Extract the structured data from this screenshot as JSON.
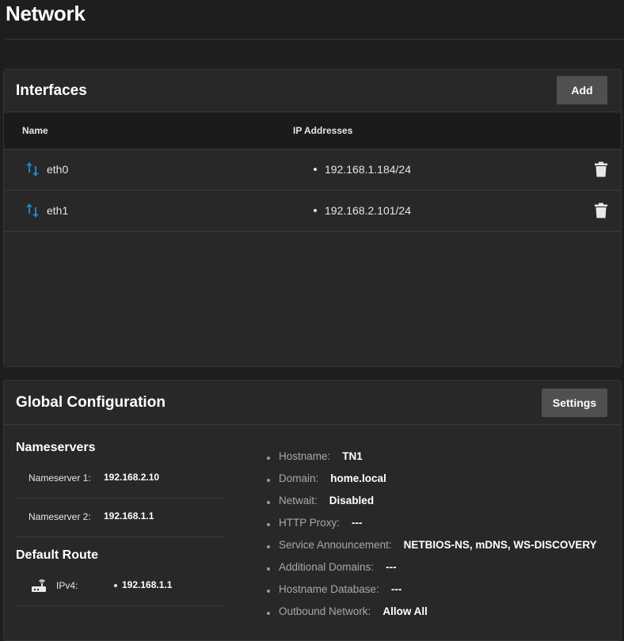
{
  "page": {
    "title": "Network"
  },
  "interfaces": {
    "title": "Interfaces",
    "add_label": "Add",
    "columns": {
      "name": "Name",
      "ip": "IP Addresses"
    },
    "rows": [
      {
        "name": "eth0",
        "ip": "192.168.1.184/24",
        "icon": "swap-vert-icon"
      },
      {
        "name": "eth1",
        "ip": "192.168.2.101/24",
        "icon": "swap-vert-icon"
      }
    ]
  },
  "global": {
    "title": "Global Configuration",
    "settings_label": "Settings",
    "nameservers": {
      "title": "Nameservers",
      "items": [
        {
          "label": "Nameserver 1:",
          "value": "192.168.2.10"
        },
        {
          "label": "Nameserver 2:",
          "value": "192.168.1.1"
        }
      ]
    },
    "default_route": {
      "title": "Default Route",
      "label": "IPv4:",
      "value": "192.168.1.1",
      "icon": "router-icon"
    },
    "config": [
      {
        "label": "Hostname:",
        "value": "TN1"
      },
      {
        "label": "Domain:",
        "value": "home.local"
      },
      {
        "label": "Netwait:",
        "value": "Disabled"
      },
      {
        "label": "HTTP Proxy:",
        "value": "---"
      },
      {
        "label": "Service Announcement:",
        "value": "NETBIOS-NS, mDNS, WS-DISCOVERY"
      },
      {
        "label": "Additional Domains:",
        "value": "---"
      },
      {
        "label": "Hostname Database:",
        "value": "---"
      },
      {
        "label": "Outbound Network:",
        "value": "Allow All"
      }
    ]
  },
  "colors": {
    "accent": "#0095d5",
    "background": "#1e1e1e",
    "card": "#282828",
    "button": "#505050"
  }
}
